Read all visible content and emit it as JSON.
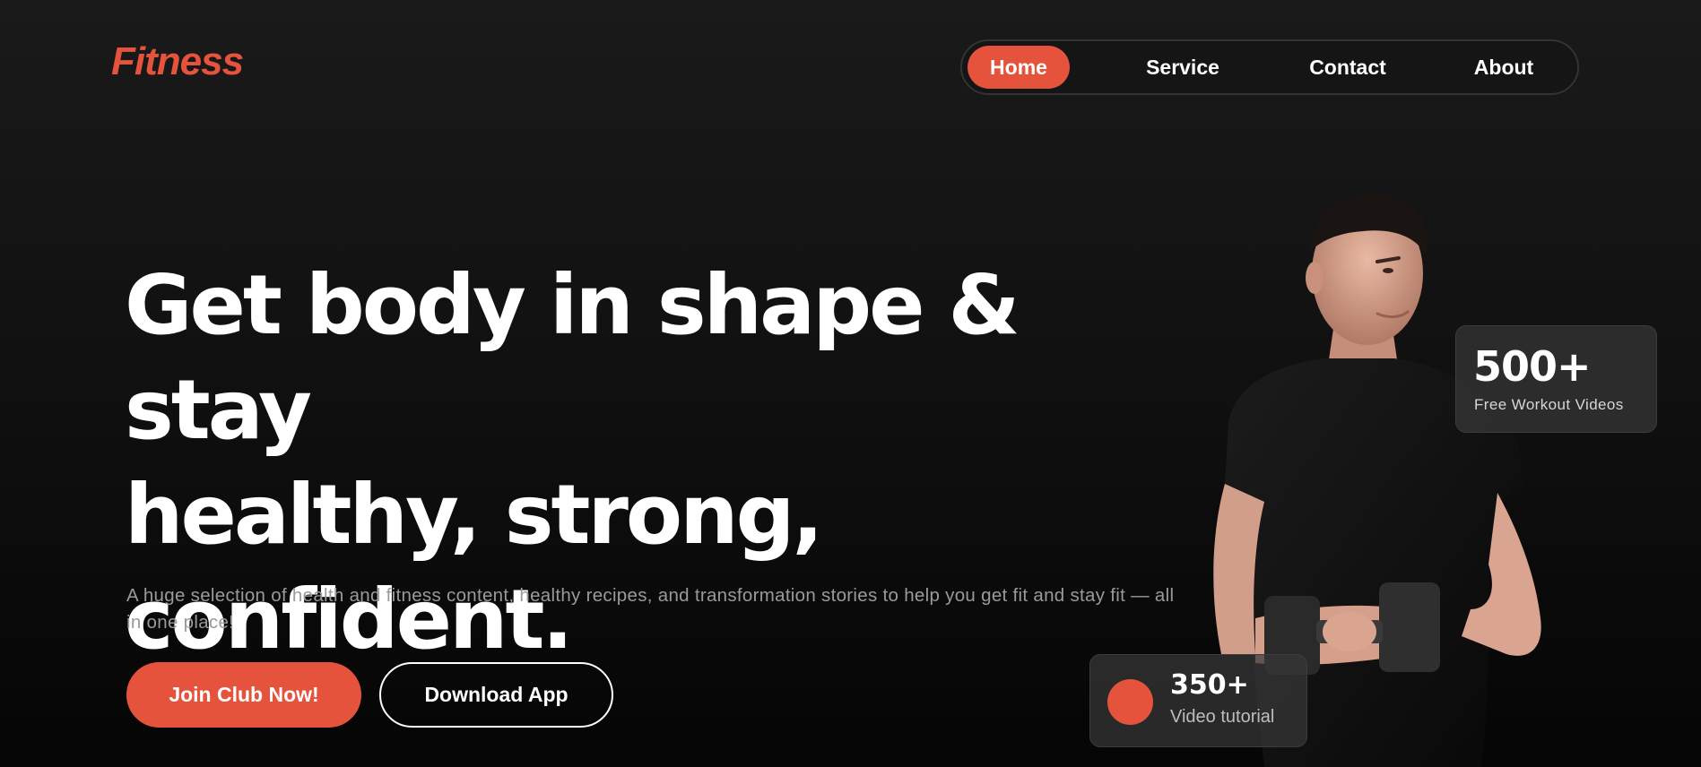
{
  "brand": {
    "logo_text": "Fitness",
    "accent_color": "#e6533c"
  },
  "nav": {
    "items": [
      {
        "label": "Home",
        "active": true
      },
      {
        "label": "Service",
        "active": false
      },
      {
        "label": "Contact",
        "active": false
      },
      {
        "label": "About",
        "active": false
      }
    ]
  },
  "hero": {
    "headline_line1": "Get body in shape & stay",
    "headline_line2": "healthy, strong,",
    "headline_line3": "confident.",
    "subtext": "A huge selection of health and fitness content, healthy recipes, and transformation stories to help you get fit and stay fit — all in one place!",
    "primary_button": "Join Club Now!",
    "secondary_button": "Download App"
  },
  "stats": {
    "videos": {
      "value": "500+",
      "label": "Free Workout Videos"
    },
    "tutorials": {
      "value": "350+",
      "label": "Video tutorial"
    }
  },
  "icons": {
    "hero_figure": "man-with-dumbbell-image",
    "tutorial_marker": "red-circle-icon"
  }
}
